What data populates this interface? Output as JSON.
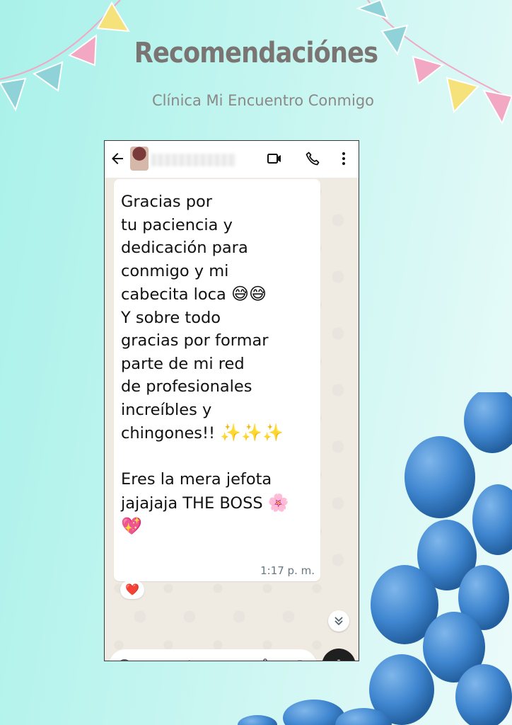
{
  "header": {
    "title": "Recomendaciónes",
    "subtitle": "Clínica Mi Encuentro Conmigo"
  },
  "decor": {
    "bunting_colors": [
      "#8fd3d8",
      "#f6e27a",
      "#f2a7c3"
    ],
    "balloon_color": "#3f86d0"
  },
  "chat_window": {
    "toolbar": {
      "back_icon": "arrow-left-icon",
      "video_icon": "video-call-icon",
      "call_icon": "phone-icon",
      "menu_icon": "more-vert-icon"
    },
    "message": {
      "text_part1": "Gracias por\ntu paciencia y\ndedicación para\nconmigo y mi\ncabecita loca ",
      "emoji1": "😅😅",
      "text_part2": "\nY sobre todo\ngracias por formar\nparte de mi red\nde profesionales\nincreíbles y\nchingones!! ",
      "emoji2": "✨✨✨",
      "text_part3": "\n\nEres la mera jefota\njajajaja THE BOSS ",
      "emoji3": "🌸",
      "emoji4": "💖",
      "time": "1:17 p. m."
    },
    "reaction": "❤️",
    "input": {
      "placeholder": "Mensaje",
      "value": ""
    },
    "accent_color": "#1f1f1f"
  }
}
